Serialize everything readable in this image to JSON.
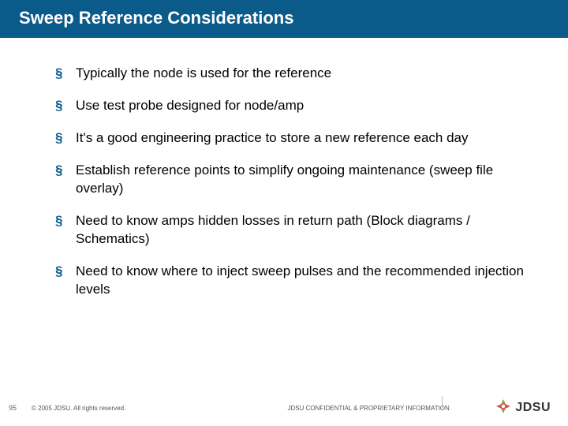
{
  "title": "Sweep Reference Considerations",
  "bullets": [
    "Typically the node is used for the reference",
    "Use test probe designed for node/amp",
    "It's a good engineering practice to store a new reference each day",
    "Establish reference points to simplify ongoing maintenance (sweep file overlay)",
    "Need to know amps hidden losses in return path (Block diagrams / Schematics)",
    "Need to know where to inject sweep pulses and the recommended injection levels"
  ],
  "footer": {
    "page": "95",
    "copyright": "© 2005 JDSU. All rights reserved.",
    "confidential": "JDSU CONFIDENTIAL & PROPRIETARY INFORMATION",
    "logo_text": "JDSU"
  }
}
